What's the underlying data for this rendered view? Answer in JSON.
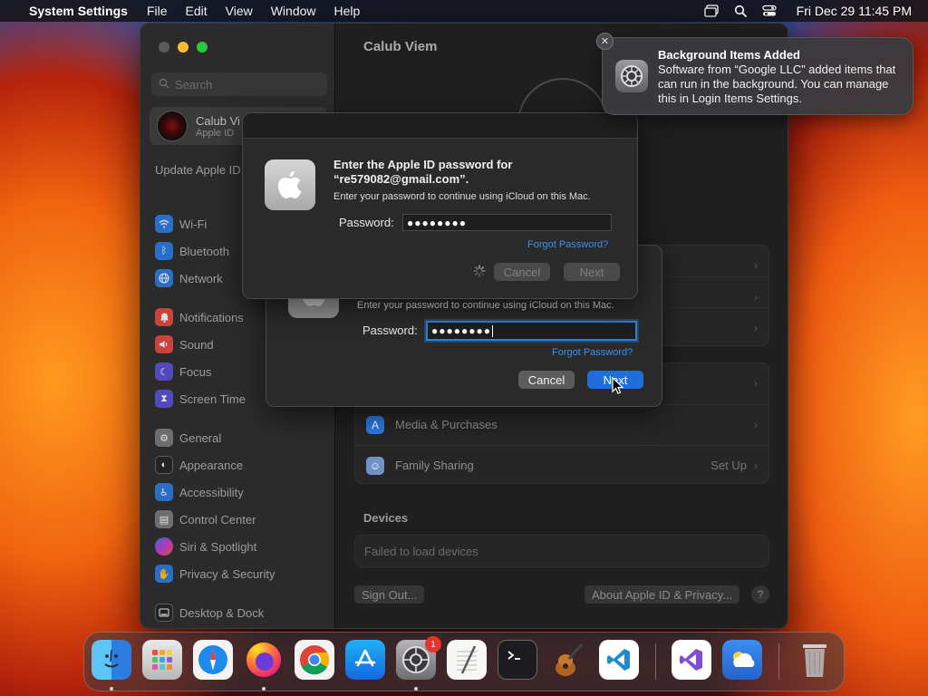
{
  "menubar": {
    "app_name": "System Settings",
    "menus": [
      "File",
      "Edit",
      "View",
      "Window",
      "Help"
    ],
    "clock": "Fri Dec 29  11:45 PM"
  },
  "sidebar": {
    "search_placeholder": "Search",
    "account_name": "Calub Vi",
    "account_sub": "Apple ID",
    "update_note": "Update Apple ID Settings",
    "items": [
      {
        "label": "Wi-Fi",
        "icon": "wifi-icon",
        "color": "#2a7ae4"
      },
      {
        "label": "Bluetooth",
        "icon": "bluetooth-icon",
        "color": "#2a7ae4"
      },
      {
        "label": "Network",
        "icon": "globe-icon",
        "color": "#2a7ae4"
      },
      {
        "label": "Notifications",
        "icon": "bell-icon",
        "color": "#e5483d"
      },
      {
        "label": "Sound",
        "icon": "speaker-icon",
        "color": "#e5483d"
      },
      {
        "label": "Focus",
        "icon": "moon-icon",
        "color": "#5b4fd6"
      },
      {
        "label": "Screen Time",
        "icon": "hourglass-icon",
        "color": "#5b4fd6"
      },
      {
        "label": "General",
        "icon": "gear-icon",
        "color": "#7a7a7a"
      },
      {
        "label": "Appearance",
        "icon": "appearance-icon",
        "color": "#222222"
      },
      {
        "label": "Accessibility",
        "icon": "accessibility-icon",
        "color": "#2a7ae4"
      },
      {
        "label": "Control Center",
        "icon": "control-center-icon",
        "color": "#7a7a7a"
      },
      {
        "label": "Siri & Spotlight",
        "icon": "siri-icon",
        "color": "#b43cc2"
      },
      {
        "label": "Privacy & Security",
        "icon": "hand-icon",
        "color": "#2a7ae4"
      },
      {
        "label": "Desktop & Dock",
        "icon": "dock-icon",
        "color": "#222222"
      }
    ]
  },
  "content": {
    "title": "Calub Viem",
    "rows": [
      {
        "label": "Media & Purchases",
        "right": "",
        "icon": "app-store-icon",
        "color": "#2a7ae4"
      },
      {
        "label": "Family Sharing",
        "right": "Set Up",
        "icon": "family-icon",
        "color": "#6f93c8"
      }
    ],
    "devices_title": "Devices",
    "devices_message": "Failed to load devices",
    "sign_out": "Sign Out...",
    "about": "About Apple ID & Privacy...",
    "help": "?"
  },
  "dialog_front": {
    "heading": "Enter the Apple ID password for “re579082@gmail.com”.",
    "sub": "Enter your password to continue using iCloud on this Mac.",
    "password_label": "Password:",
    "password_value": "●●●●●●●●",
    "forgot": "Forgot Password?",
    "cancel": "Cancel",
    "next": "Next"
  },
  "dialog_back": {
    "sub": "Enter your password to continue using iCloud on this Mac.",
    "password_label": "Password:",
    "password_value": "●●●●●●●●",
    "forgot": "Forgot Password?",
    "cancel": "Cancel",
    "next": "Next"
  },
  "notification": {
    "title": "Background Items Added",
    "body": "Software from “Google LLC” added items that can run in the background. You can manage this in Login Items Settings.",
    "close": "✕"
  },
  "dock": {
    "badge_count": "1",
    "apps": [
      "finder-icon",
      "launchpad-icon",
      "safari-icon",
      "firefox-icon",
      "chrome-icon",
      "app-store-icon",
      "system-settings-icon",
      "textedit-icon",
      "terminal-icon",
      "instruments-icon",
      "vscode-icon",
      "visual-studio-icon",
      "weather-icon",
      "trash-icon"
    ]
  }
}
